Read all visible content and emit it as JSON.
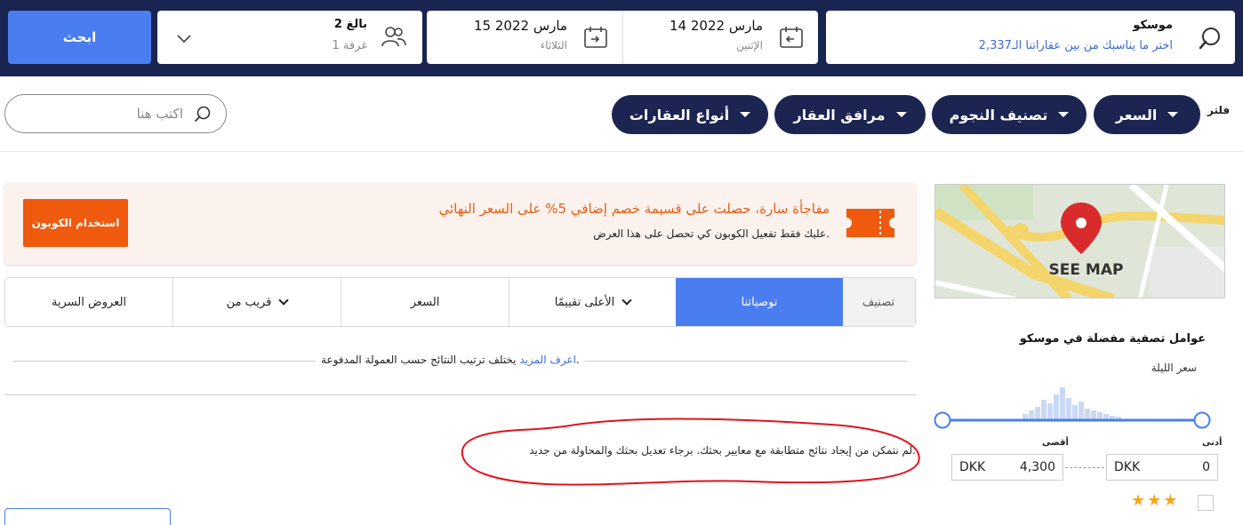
{
  "header": {
    "destination": {
      "title": "موسكو",
      "subtitle": "اختر ما يناسبك من بين عقاراتنا الـ2,337"
    },
    "checkin": {
      "date": "14 مارس 2022",
      "day": "الإثنين"
    },
    "checkout": {
      "date": "15 مارس 2022",
      "day": "الثلاثاء"
    },
    "guests": {
      "adults": "2 بالغ",
      "rooms": "1 غرفة"
    },
    "search_button": "ابحث"
  },
  "filters": {
    "label": "فلتر",
    "pills": [
      "السعر",
      "تصنيف النجوم",
      "مرافق العقار",
      "أنواع العقارات"
    ],
    "search_placeholder": "اكتب هنا"
  },
  "coupon": {
    "title": "مفاجأة سارة، حصلت على قسيمة خصم إضافي 5% على السعر النهائي",
    "subtitle": "عليك فقط تفعيل الكوبون كي تحصل على هذا العرض.",
    "button": "استخدام الكوبون"
  },
  "sort": {
    "label": "تصنيف",
    "options": [
      {
        "label": "توصياتنا",
        "active": true
      },
      {
        "label": "الأعلى تقييمًا",
        "dropdown": true
      },
      {
        "label": "السعر"
      },
      {
        "label": "قريب من",
        "dropdown": true
      },
      {
        "label": "العروض السرية"
      }
    ]
  },
  "info": {
    "text": "يختلف ترتيب النتائج حسب العمولة المدفوعة.",
    "link": "اعرف المزيد"
  },
  "no_results": "لم نتمكن من إيجاد نتائج متطابقة مع معايير بحثك. برجاء تعديل بحثك والمحاولة من جديد.",
  "sidebar": {
    "map_label": "SEE MAP",
    "title": "عوامل تصفية مفضلة في موسكو",
    "price_title": "سعر الليلة",
    "min_label": "أدنى",
    "max_label": "أقصى",
    "min_value": "0",
    "max_value": "4,300",
    "currency": "DKK",
    "stars": "★★★"
  },
  "colors": {
    "navy": "#1a2450",
    "blue": "#4a7ef0",
    "orange": "#ef5a0e",
    "annotation_red": "#e0141e"
  }
}
